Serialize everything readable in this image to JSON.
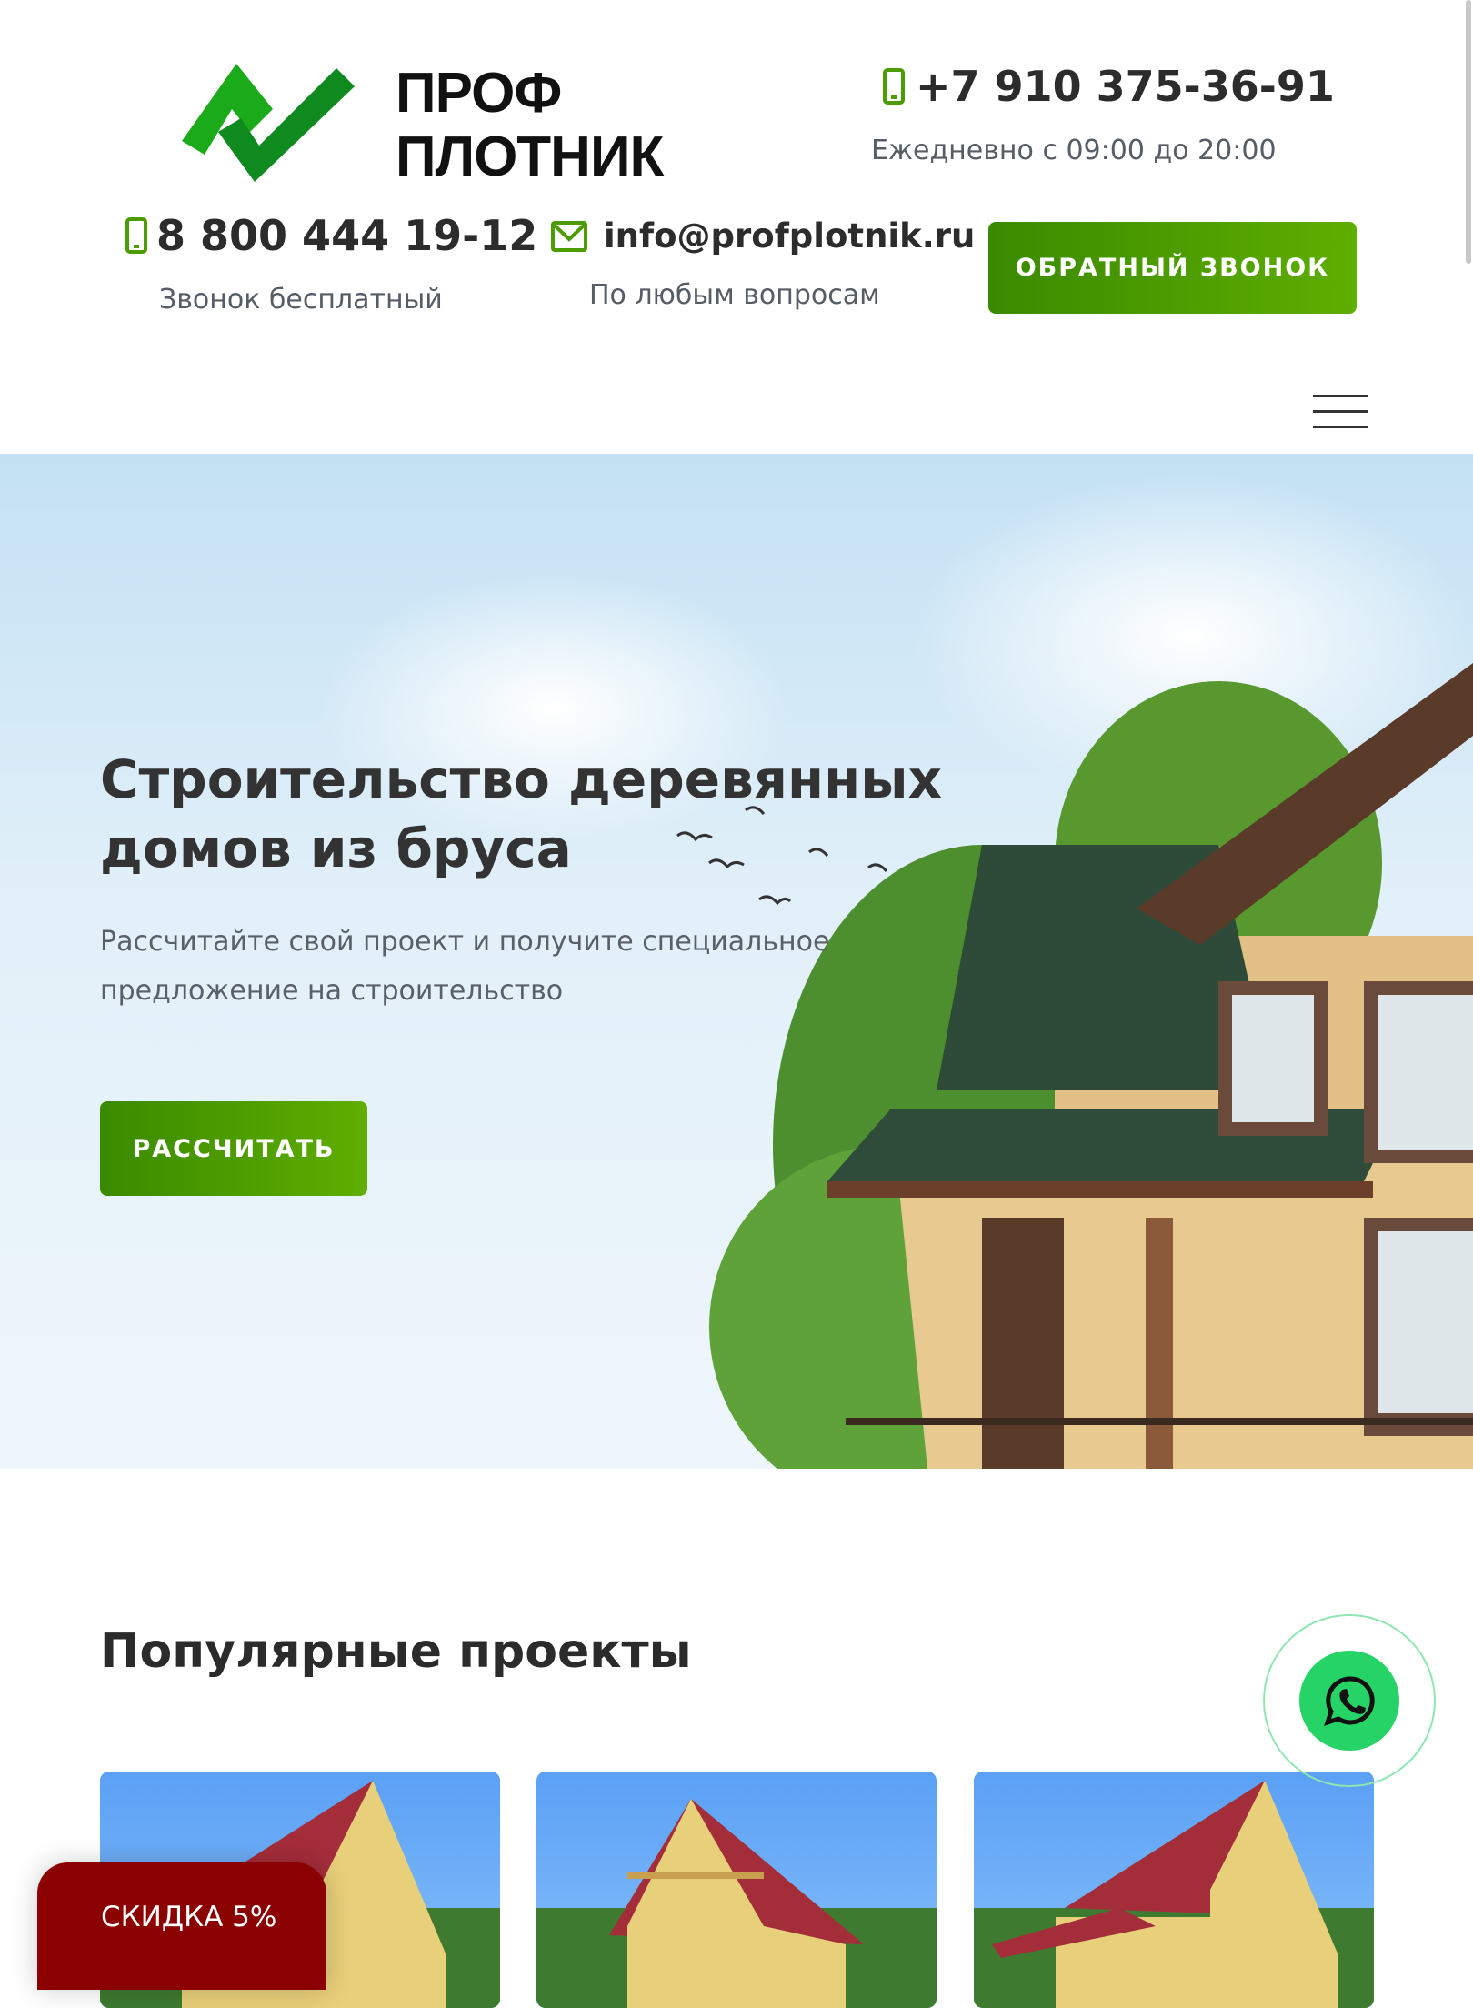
{
  "header": {
    "logo_text": [
      "ПРОФ",
      "ПЛОТНИК"
    ],
    "phone_main": "+7 910 375-36-91",
    "schedule": "Ежедневно с 09:00 до 20:00",
    "phone_free": "8 800 444 19-12",
    "phone_free_caption": "Звонок бесплатный",
    "email": "info@profplotnik.ru",
    "email_caption": "По любым вопросам",
    "callback_button": "ОБРАТНЫЙ ЗВОНОК"
  },
  "hero": {
    "title_line1": "Строительство деревянных",
    "title_line2": "домов из бруса",
    "subtitle_line1": "Рассчитайте свой проект и получите специальное",
    "subtitle_line2": "предложение на строительство",
    "button": "РАССЧИТАТЬ"
  },
  "projects": {
    "title": "Популярные проекты"
  },
  "discount": {
    "label": "СКИДКА 5%"
  },
  "colors": {
    "accent": "#4c9c00",
    "discount": "#8b0000",
    "whatsapp": "#25d366"
  }
}
